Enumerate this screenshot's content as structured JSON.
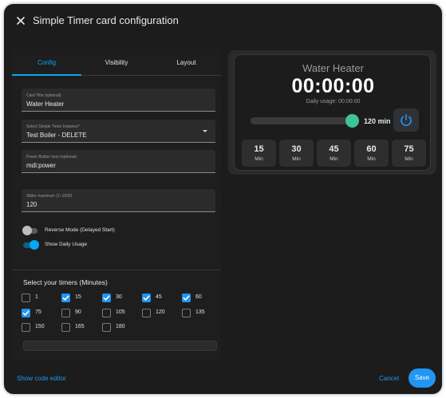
{
  "dialog": {
    "title": "Simple Timer card configuration",
    "close_icon": "close-icon"
  },
  "tabs": [
    {
      "label": "Config",
      "active": true
    },
    {
      "label": "Visibility",
      "active": false
    },
    {
      "label": "Layout",
      "active": false
    }
  ],
  "fields": {
    "card_title": {
      "label": "Card Title (optional)",
      "value": "Water Heater"
    },
    "instance": {
      "label": "Select Simple Timer Instance*",
      "value": "Test Boiler - DELETE"
    },
    "power_icon": {
      "label": "Power Button Icon (optional)",
      "value": "mdi:power"
    },
    "slider_max": {
      "label": "Slider maximum (1–1000)",
      "value": "120"
    }
  },
  "switches": {
    "reverse_mode": {
      "label": "Reverse Mode (Delayed Start)",
      "on": false
    },
    "daily_usage": {
      "label": "Show Daily Usage",
      "on": true
    }
  },
  "timers": {
    "title": "Select your timers (Minutes)",
    "options": [
      {
        "label": "1",
        "checked": false
      },
      {
        "label": "15",
        "checked": true
      },
      {
        "label": "30",
        "checked": true
      },
      {
        "label": "45",
        "checked": true
      },
      {
        "label": "60",
        "checked": true
      },
      {
        "label": "75",
        "checked": true
      },
      {
        "label": "90",
        "checked": false
      },
      {
        "label": "105",
        "checked": false
      },
      {
        "label": "120",
        "checked": false
      },
      {
        "label": "135",
        "checked": false
      },
      {
        "label": "150",
        "checked": false
      },
      {
        "label": "165",
        "checked": false
      },
      {
        "label": "180",
        "checked": false
      }
    ]
  },
  "preview": {
    "title": "Water Heater",
    "timer": "00:00:00",
    "daily_usage": "Daily usage: 00:00:00",
    "slider_value": "120 min",
    "slider_level": 1.0,
    "power_icon": "power-icon",
    "presets": [
      {
        "value": "15",
        "unit": "Min"
      },
      {
        "value": "30",
        "unit": "Min"
      },
      {
        "value": "45",
        "unit": "Min"
      },
      {
        "value": "60",
        "unit": "Min"
      },
      {
        "value": "75",
        "unit": "Min"
      }
    ]
  },
  "footer": {
    "code_editor": "Show code editor",
    "cancel": "Cancel",
    "save": "Save"
  },
  "colors": {
    "accent": "#2196f3",
    "tab_active": "#03a9f4",
    "slider_thumb": "#3ec29a",
    "background": "#1c1c1c"
  }
}
